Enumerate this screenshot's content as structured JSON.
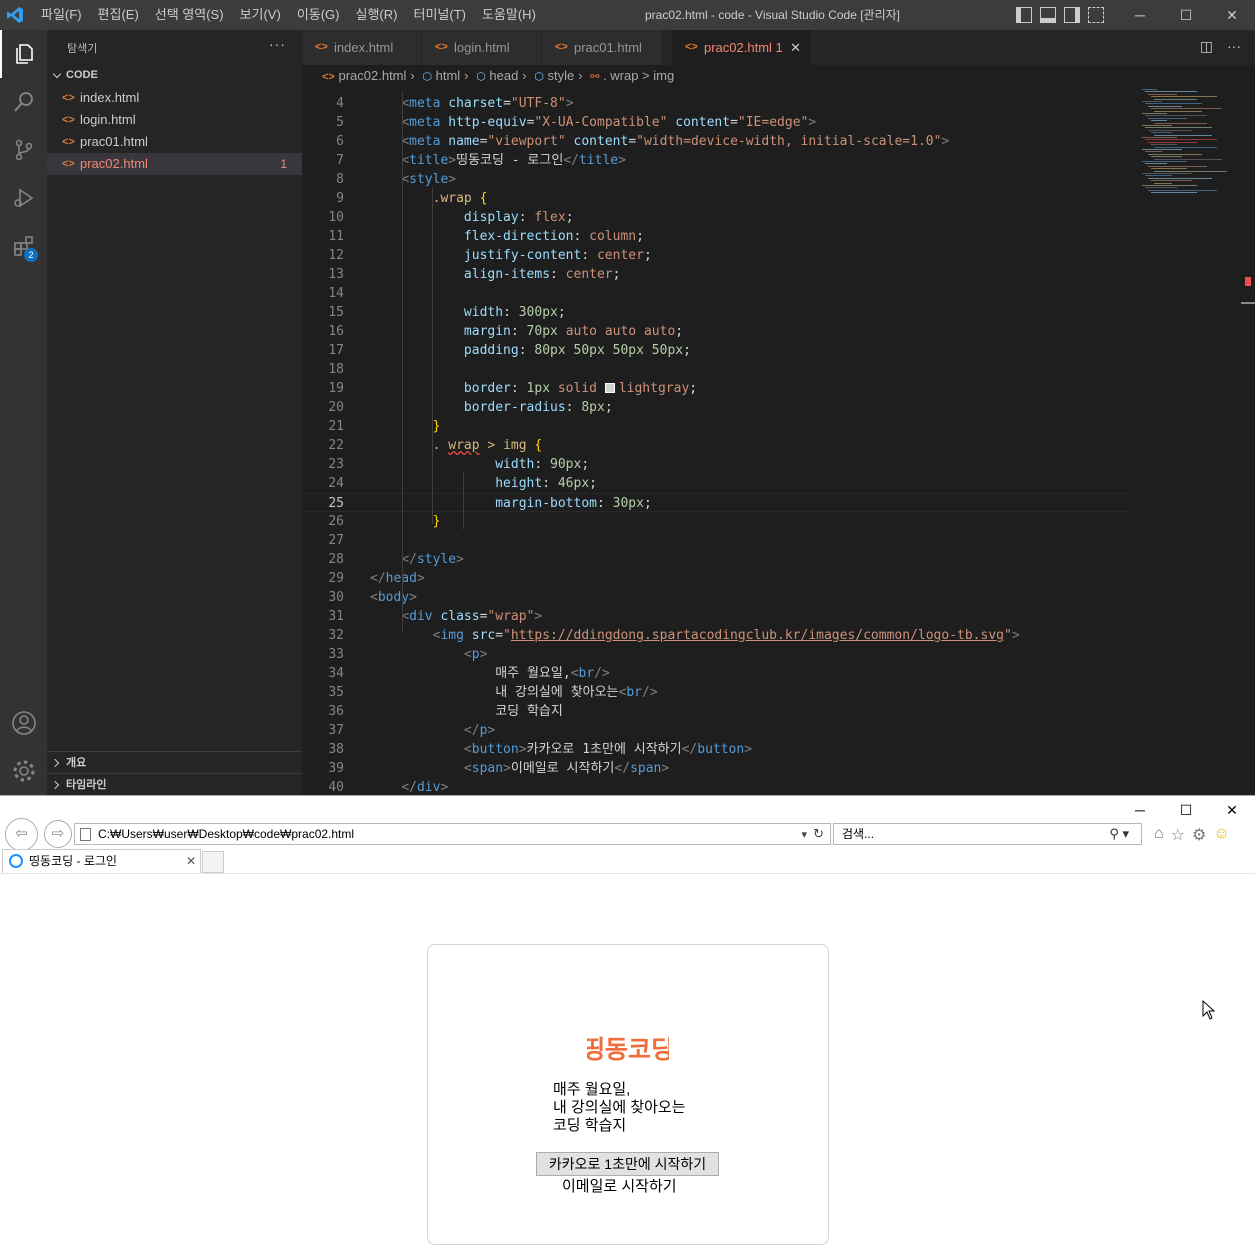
{
  "vscode": {
    "menu": [
      "파일(F)",
      "편집(E)",
      "선택 영역(S)",
      "보기(V)",
      "이동(G)",
      "실행(R)",
      "터미널(T)",
      "도움말(H)"
    ],
    "window_title": "prac02.html - code - Visual Studio Code [관리자]",
    "extensions_badge": "2",
    "sidebar": {
      "title": "탐색기",
      "more": "···",
      "folder": "CODE",
      "files": [
        {
          "name": "index.html",
          "count": ""
        },
        {
          "name": "login.html",
          "count": ""
        },
        {
          "name": "prac01.html",
          "count": ""
        },
        {
          "name": "prac02.html",
          "count": "1"
        }
      ],
      "outline": "개요",
      "timeline": "타임라인"
    },
    "tabs": [
      {
        "name": "index.html"
      },
      {
        "name": "login.html"
      },
      {
        "name": "prac01.html"
      },
      {
        "name": "prac02.html 1"
      }
    ],
    "breadcrumb": [
      "prac02.html",
      "html",
      "head",
      "style",
      ". wrap > img"
    ],
    "lines": [
      {
        "n": "4",
        "t": "    <meta charset=\"UTF-8\">"
      },
      {
        "n": "5",
        "t": "    <meta http-equiv=\"X-UA-Compatible\" content=\"IE=edge\">"
      },
      {
        "n": "6",
        "t": "    <meta name=\"viewport\" content=\"width=device-width, initial-scale=1.0\">"
      },
      {
        "n": "7",
        "t": "    <title>띵동코딩 - 로그인</title>"
      },
      {
        "n": "8",
        "t": "    <style>"
      },
      {
        "n": "9",
        "t": "        .wrap {"
      },
      {
        "n": "10",
        "t": "            display: flex;"
      },
      {
        "n": "11",
        "t": "            flex-direction: column;"
      },
      {
        "n": "12",
        "t": "            justify-content: center;"
      },
      {
        "n": "13",
        "t": "            align-items: center;"
      },
      {
        "n": "14",
        "t": ""
      },
      {
        "n": "15",
        "t": "            width: 300px;"
      },
      {
        "n": "16",
        "t": "            margin: 70px auto auto auto;"
      },
      {
        "n": "17",
        "t": "            padding: 80px 50px 50px 50px;"
      },
      {
        "n": "18",
        "t": ""
      },
      {
        "n": "19",
        "t": "            border: 1px solid lightgray;"
      },
      {
        "n": "20",
        "t": "            border-radius: 8px;"
      },
      {
        "n": "21",
        "t": "        }"
      },
      {
        "n": "22",
        "t": "        . wrap > img {"
      },
      {
        "n": "23",
        "t": "                width: 90px;"
      },
      {
        "n": "24",
        "t": "                height: 46px;"
      },
      {
        "n": "25",
        "t": "                margin-bottom: 30px;"
      },
      {
        "n": "26",
        "t": "        }"
      },
      {
        "n": "27",
        "t": ""
      },
      {
        "n": "28",
        "t": "    </style>"
      },
      {
        "n": "29",
        "t": "</head>"
      },
      {
        "n": "30",
        "t": "<body>"
      },
      {
        "n": "31",
        "t": "    <div class=\"wrap\">"
      },
      {
        "n": "32",
        "t": "        <img src=\"https://ddingdong.spartacodingclub.kr/images/common/logo-tb.svg\">"
      },
      {
        "n": "33",
        "t": "            <p>"
      },
      {
        "n": "34",
        "t": "                매주 월요일,<br/>"
      },
      {
        "n": "35",
        "t": "                내 강의실에 찾아오는<br/>"
      },
      {
        "n": "36",
        "t": "                코딩 학습지"
      },
      {
        "n": "37",
        "t": "            </p>"
      },
      {
        "n": "38",
        "t": "            <button>카카오로 1초만에 시작하기</button>"
      },
      {
        "n": "39",
        "t": "            <span>이메일로 시작하기</span>"
      },
      {
        "n": "40",
        "t": "    </div>"
      }
    ]
  },
  "ie": {
    "address": "C:₩Users₩user₩Desktop₩code₩prac02.html",
    "search_placeholder": "검색...",
    "tab_title": "띵동코딩 - 로그인",
    "page": {
      "logo_text": "띵동코딩",
      "p_lines": [
        "매주 월요일,",
        "내 강의실에 찾아오는",
        "코딩 학습지"
      ],
      "button": "카카오로 1초만에 시작하기",
      "span": "이메일로 시작하기"
    }
  },
  "colors": {
    "accent_logo": "#f06d3c",
    "vscode_blue": "#0e70c0",
    "error": "#f48771"
  }
}
